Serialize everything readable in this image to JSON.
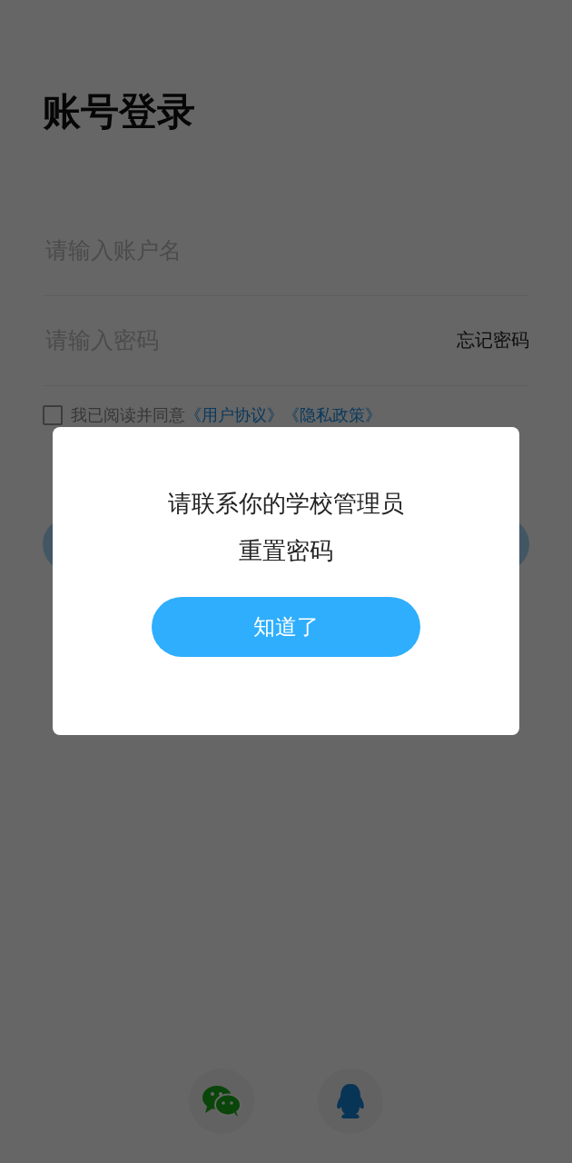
{
  "title": "账号登录",
  "fields": [
    {
      "placeholder": "请输入账户名"
    },
    {
      "placeholder": "请输入密码",
      "action": "忘记密码"
    }
  ],
  "agreement": {
    "checked": false,
    "text": "我已阅读并同意",
    "links": [
      "《用户协议》",
      "《隐私政策》"
    ]
  },
  "dialog": {
    "message": [
      "请联系你的学校管理员",
      "重置密码"
    ],
    "button": "知道了"
  },
  "social_logins": [
    {
      "kind": "wechat"
    },
    {
      "kind": "qq"
    }
  ]
}
